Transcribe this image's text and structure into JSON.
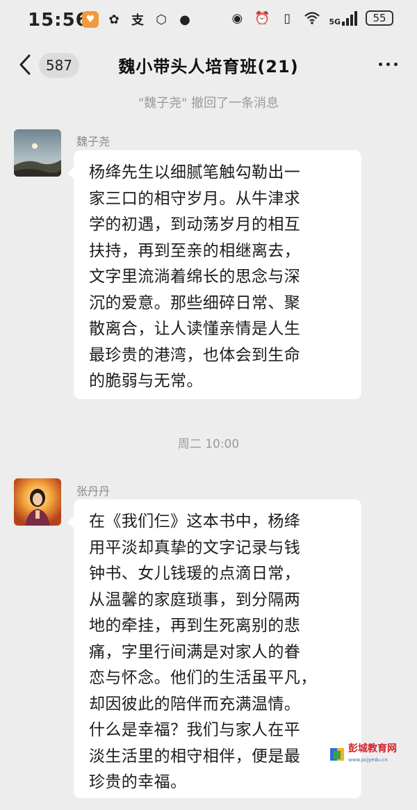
{
  "status_bar": {
    "time": "15:56",
    "left_icons": [
      "shield-badge-icon",
      "link-icon",
      "alipay-icon",
      "soul-icon",
      "chat-icon"
    ],
    "right_icons": [
      "eye-icon",
      "alarm-icon",
      "vibrate-icon",
      "wifi-icon",
      "5g-signal-icon"
    ],
    "network": "5G",
    "battery": "55"
  },
  "header": {
    "unread_count": "587",
    "title": "魏小带头人培育班(21)"
  },
  "system_message": "\"魏子尧\" 撤回了一条消息",
  "messages": [
    {
      "sender": "魏子尧",
      "lines": [
        "杨绛先生以细腻笔触勾勒出一",
        "家三口的相守岁月。从牛津求",
        "学的初遇，到动荡岁月的相互",
        "扶持，再到至亲的相继离去，",
        "文字里流淌着绵长的思念与深",
        "沉的爱意。那些细碎日常、聚",
        "散离合，让人读懂亲情是人生",
        "最珍贵的港湾，也体会到生命",
        "的脆弱与无常。"
      ]
    },
    {
      "sender": "张丹丹",
      "lines": [
        "在《我们仨》这本书中，杨绛",
        "用平淡却真挚的文字记录与钱",
        "钟书、女儿钱瑗的点滴日常，",
        "从温馨的家庭琐事，到分隔两",
        "地的牵挂，再到生死离别的悲",
        "痛，字里行间满是对家人的眷",
        "恋与怀念。他们的生活虽平凡，",
        "却因彼此的陪伴而充满温情。",
        "什么是幸福？我们与家人在平",
        "淡生活里的相守相伴，便是最",
        "珍贵的幸福。"
      ]
    }
  ],
  "time_separator": "周二 10:00",
  "watermark": {
    "name": "彭城教育网",
    "url": "www.pcjyedu.cn"
  }
}
